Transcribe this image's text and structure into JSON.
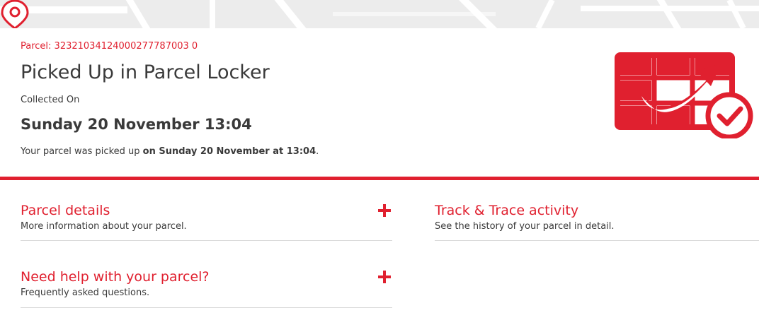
{
  "parcel": {
    "number_label": "Parcel: 32321034124000277787003 0"
  },
  "status": {
    "title": "Picked Up in Parcel Locker",
    "collected_label": "Collected On",
    "collected_date": "Sunday 20 November 13:04",
    "summary_prefix": "Your parcel was picked up ",
    "summary_bold": "on Sunday 20 November at 13:04",
    "summary_suffix": "."
  },
  "sections": {
    "parcel_details": {
      "title": "Parcel details",
      "subtitle": "More information about your parcel."
    },
    "help": {
      "title": "Need help with your parcel?",
      "subtitle": "Frequently asked questions."
    },
    "track_trace": {
      "title": "Track & Trace activity",
      "subtitle": "See the history of your parcel in detail."
    }
  },
  "icons": {
    "map_pin": "map-pin-icon",
    "locker": "parcel-locker-check-icon",
    "expand": "plus-icon"
  },
  "colors": {
    "accent": "#e0202f",
    "text": "#3a3a3a",
    "divider": "#d9d9d9",
    "map_bg": "#ececec"
  }
}
